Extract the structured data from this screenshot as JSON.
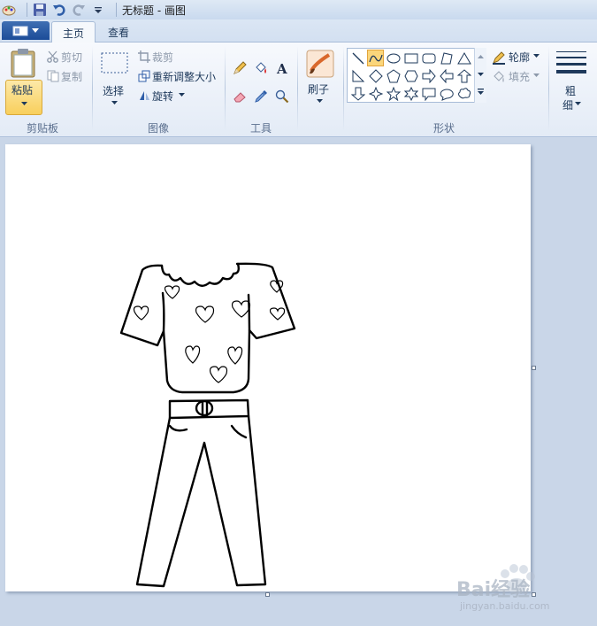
{
  "window": {
    "title": "无标题 - 画图"
  },
  "tabs": [
    {
      "label": "主页",
      "active": true
    },
    {
      "label": "查看",
      "active": false
    }
  ],
  "clipboard": {
    "paste": "粘贴",
    "cut": "剪切",
    "copy": "复制",
    "group_label": "剪贴板"
  },
  "image": {
    "select": "选择",
    "crop": "裁剪",
    "resize": "重新调整大小",
    "rotate": "旋转",
    "group_label": "图像"
  },
  "tools": {
    "group_label": "工具",
    "items": [
      "pencil-icon",
      "fill-icon",
      "text-icon",
      "eraser-icon",
      "color-picker-icon",
      "magnifier-icon"
    ]
  },
  "brushes": {
    "label": "刷子"
  },
  "shapes": {
    "group_label": "形状",
    "outline": "轮廓",
    "fill": "填充",
    "selected": "curve"
  },
  "size": {
    "label_line1": "粗",
    "label_line2": "细"
  },
  "watermark": {
    "brand": "Bai经验",
    "url": "jingyan.baidu.com"
  },
  "colors": {
    "ribbon_bg": "#f5f8fc",
    "accent": "#fbd67b",
    "file_button": "#2a5aa6",
    "canvas": "#ffffff"
  }
}
